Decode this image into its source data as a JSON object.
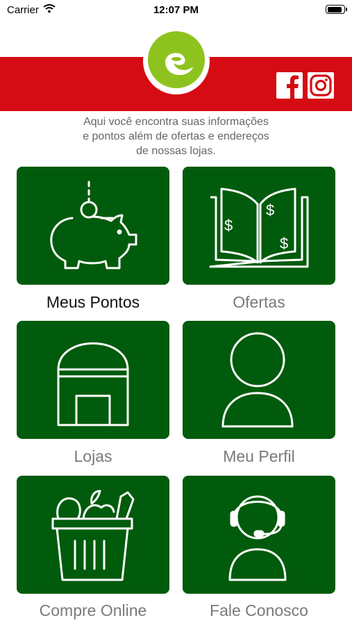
{
  "status_bar": {
    "carrier": "Carrier",
    "time": "12:07 PM",
    "battery_level": 0.9
  },
  "header": {
    "colors": {
      "band": "#d50c13",
      "logo_green": "#8ec31f"
    },
    "logo_icon": "e-swirl-logo",
    "social": [
      {
        "name": "facebook",
        "icon": "facebook-icon"
      },
      {
        "name": "instagram",
        "icon": "instagram-icon"
      }
    ]
  },
  "intro": {
    "line1": "Aqui você encontra suas informações",
    "line2": "e pontos além de ofertas e endereços",
    "line3": "de nossas lojas."
  },
  "menu": {
    "tile_color": "#015b0c",
    "items": [
      {
        "label": "Meus Pontos",
        "icon": "piggy-bank-icon",
        "selected": true
      },
      {
        "label": "Ofertas",
        "icon": "open-book-dollar-icon",
        "selected": false
      },
      {
        "label": "Lojas",
        "icon": "store-icon",
        "selected": false
      },
      {
        "label": "Meu Perfil",
        "icon": "user-icon",
        "selected": false
      },
      {
        "label": "Compre Online",
        "icon": "grocery-basket-icon",
        "selected": false
      },
      {
        "label": "Fale Conosco",
        "icon": "headset-support-icon",
        "selected": false
      }
    ]
  }
}
